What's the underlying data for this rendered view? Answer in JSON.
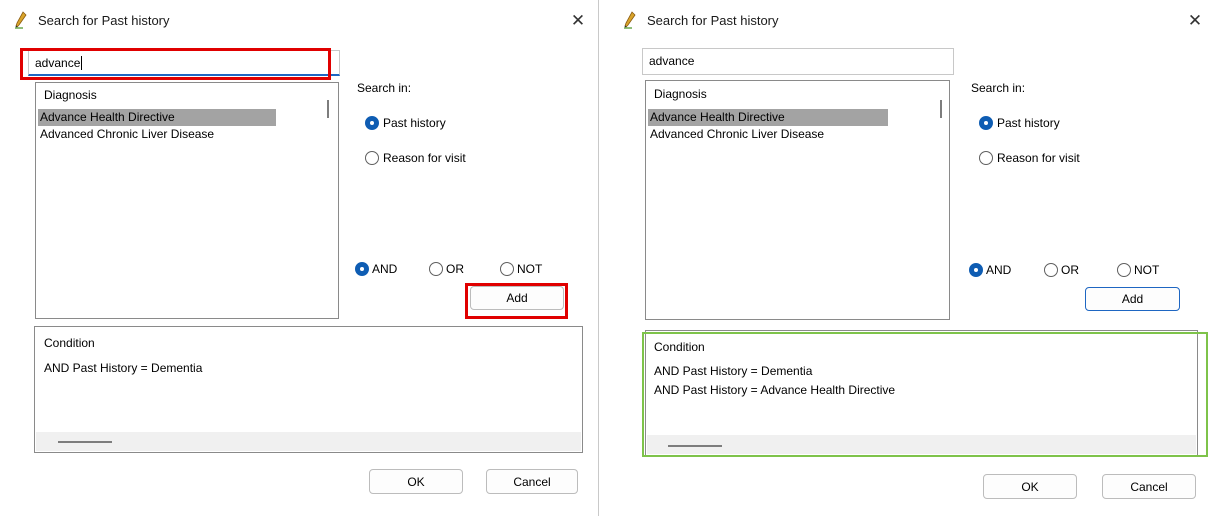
{
  "left_dialog": {
    "title": "Search for Past history",
    "search_value": "advance",
    "list_header": "Diagnosis",
    "list_items": [
      "Advance Health Directive",
      "Advanced Chronic Liver Disease"
    ],
    "search_in_label": "Search in:",
    "options": [
      "Past history",
      "Reason for visit"
    ],
    "operators": [
      "AND",
      "OR",
      "NOT"
    ],
    "add_label": "Add",
    "condition_header": "Condition",
    "conditions": [
      "AND Past History = Dementia"
    ],
    "ok_label": "OK",
    "cancel_label": "Cancel"
  },
  "right_dialog": {
    "title": "Search for Past history",
    "search_value": "advance",
    "list_header": "Diagnosis",
    "list_items": [
      "Advance Health Directive",
      "Advanced Chronic Liver Disease"
    ],
    "search_in_label": "Search in:",
    "options": [
      "Past history",
      "Reason for visit"
    ],
    "operators": [
      "AND",
      "OR",
      "NOT"
    ],
    "add_label": "Add",
    "condition_header": "Condition",
    "conditions": [
      "AND Past History = Dementia",
      "AND Past History = Advance Health Directive"
    ],
    "ok_label": "OK",
    "cancel_label": "Cancel"
  },
  "colors": {
    "accent": "#0f5db3",
    "highlight_red": "#e00000",
    "highlight_green": "#7ec34a",
    "selected_row": "#a3a3a3"
  }
}
